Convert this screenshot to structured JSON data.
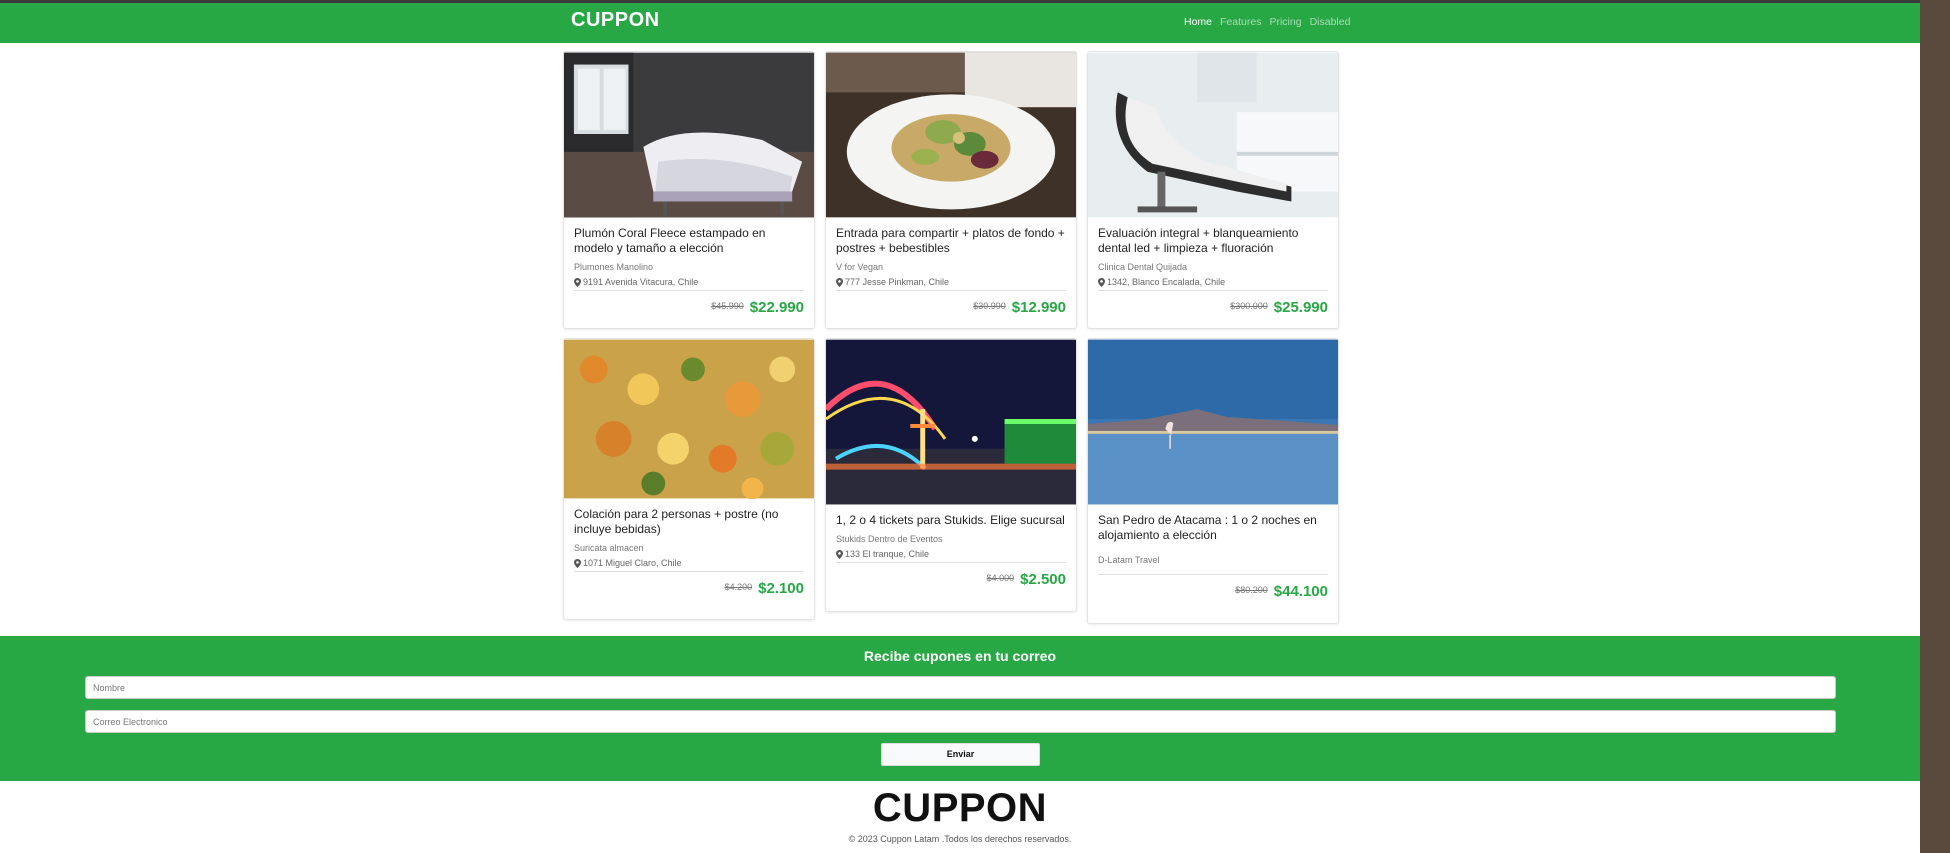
{
  "nav": {
    "brand": "CUPPON",
    "links": [
      "Home",
      "Features",
      "Pricing",
      "Disabled"
    ],
    "active": "Home"
  },
  "deals": [
    {
      "image": "bedroom-photo",
      "title": "Plumón Coral Fleece estampado en modelo y tamaño a elección",
      "vendor": "Plumones Manolino",
      "location": "9191 Avenida Vitacura, Chile",
      "old_price": "$45.990",
      "price": "$22.990"
    },
    {
      "image": "salad-bowl-photo",
      "title": "Entrada para compartir + platos de fondo + postres + bebestibles",
      "vendor": "V for Vegan",
      "location": "777 Jesse Pinkman, Chile",
      "old_price": "$30.990",
      "price": "$12.990"
    },
    {
      "image": "dental-chair-photo",
      "title": "Evaluación integral + blanqueamiento dental led + limpieza + fluoración",
      "vendor": "Clinica Dental Quijada",
      "location": "1342, Blanco Encalada, Chile",
      "old_price": "$300.000",
      "price": "$25.990"
    },
    {
      "image": "stew-photo",
      "title": "Colación para 2 personas + postre (no incluye bebidas)",
      "vendor": "Suricata almacen",
      "location": "1071 Miguel Claro, Chile",
      "old_price": "$4.200",
      "price": "$2.100"
    },
    {
      "image": "amusement-park-photo",
      "title": "1, 2 o 4 tickets para Stukids. Elige sucursal",
      "vendor": "Stukids Dentro de Eventos",
      "location": "133 El tranque, Chile",
      "old_price": "$4.000",
      "price": "$2.500"
    },
    {
      "image": "flamingo-lagoon-photo",
      "title": "San Pedro de Atacama : 1 o 2 noches en alojamiento a elección",
      "vendor": "D-Latam Travel",
      "location": "",
      "old_price": "$80.200",
      "price": "$44.100"
    }
  ],
  "newsletter": {
    "title": "Recibe cupones en tu correo",
    "name_placeholder": "Nombre",
    "email_placeholder": "Correo Electronico",
    "submit_label": "Enviar"
  },
  "footer": {
    "logo": "CUPPON",
    "copyright": "© 2023 Cuppon Latam .Todos los derechos reservados."
  },
  "colors": {
    "brand_green": "#28a745"
  }
}
